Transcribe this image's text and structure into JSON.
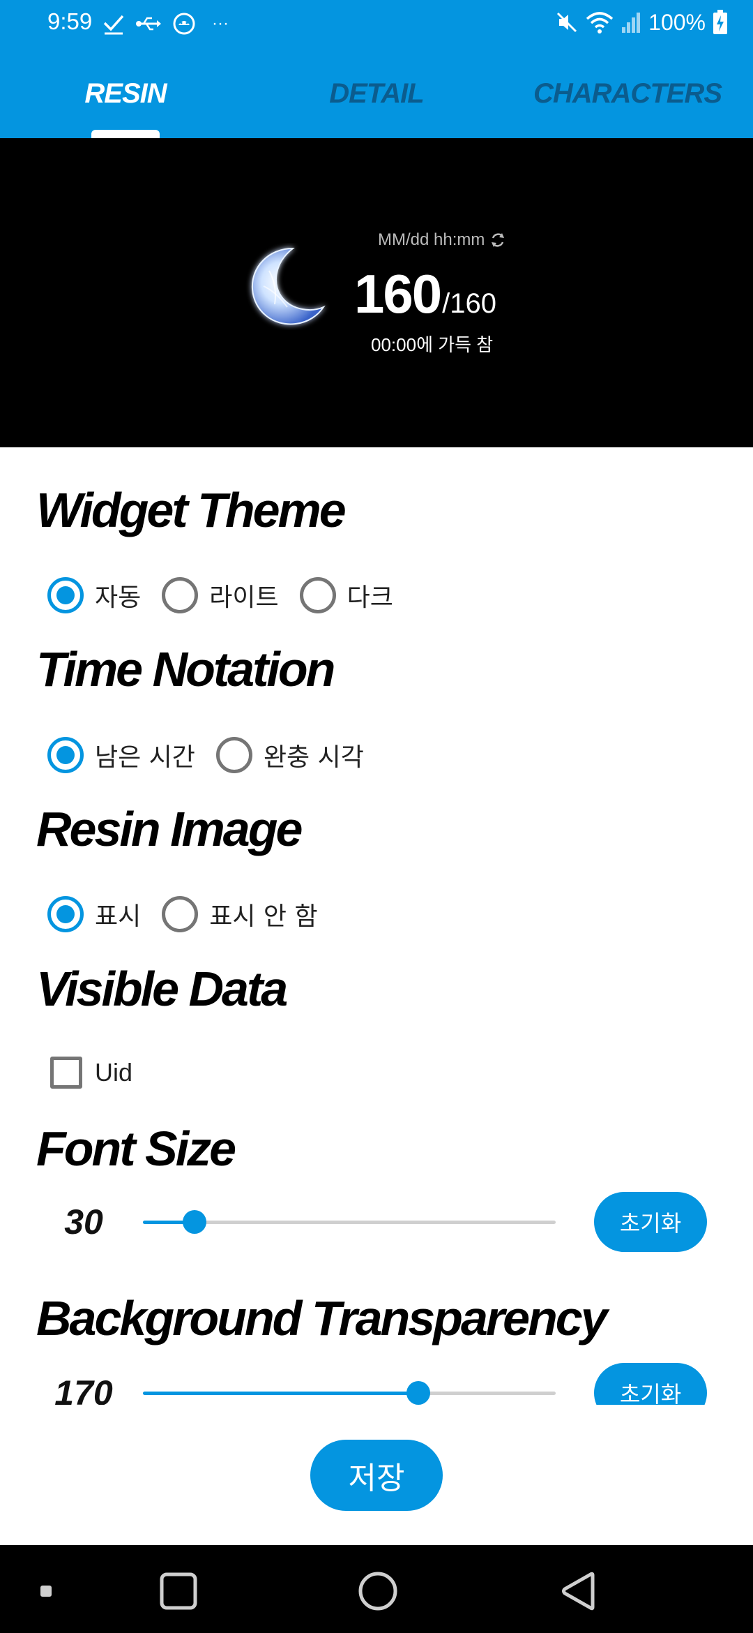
{
  "status_bar": {
    "time": "9:59",
    "battery": "100%",
    "overflow": "···",
    "icons": [
      "check-icon",
      "usb-icon",
      "android-debug-icon",
      "mute-icon",
      "wifi-icon",
      "signal-icon",
      "battery-charging-icon"
    ]
  },
  "tabs": [
    {
      "label": "RESIN",
      "active": true
    },
    {
      "label": "DETAIL",
      "active": false
    },
    {
      "label": "CHARACTERS",
      "active": false
    }
  ],
  "preview": {
    "date_format": "MM/dd hh:mm",
    "current": "160",
    "max": "/160",
    "full_text": "00:00에 가득 참"
  },
  "widget_theme": {
    "title": "Widget Theme",
    "options": [
      {
        "label": "자동",
        "checked": true
      },
      {
        "label": "라이트",
        "checked": false
      },
      {
        "label": "다크",
        "checked": false
      }
    ]
  },
  "time_notation": {
    "title": "Time Notation",
    "options": [
      {
        "label": "남은 시간",
        "checked": true
      },
      {
        "label": "완충 시각",
        "checked": false
      }
    ]
  },
  "resin_image": {
    "title": "Resin Image",
    "options": [
      {
        "label": "표시",
        "checked": true
      },
      {
        "label": "표시 안 함",
        "checked": false
      }
    ]
  },
  "visible_data": {
    "title": "Visible Data",
    "uid_label": "Uid",
    "uid_checked": false
  },
  "font_size": {
    "title": "Font Size",
    "value": "30",
    "fraction": 0.125,
    "reset_label": "초기화"
  },
  "background_transparency": {
    "title": "Background Transparency",
    "value": "170",
    "fraction": 0.667,
    "reset_label": "초기화"
  },
  "save_label": "저장",
  "colors": {
    "accent": "#0495e0",
    "tab_inactive": "#0b5c8e",
    "preview_bg": "#000000"
  }
}
